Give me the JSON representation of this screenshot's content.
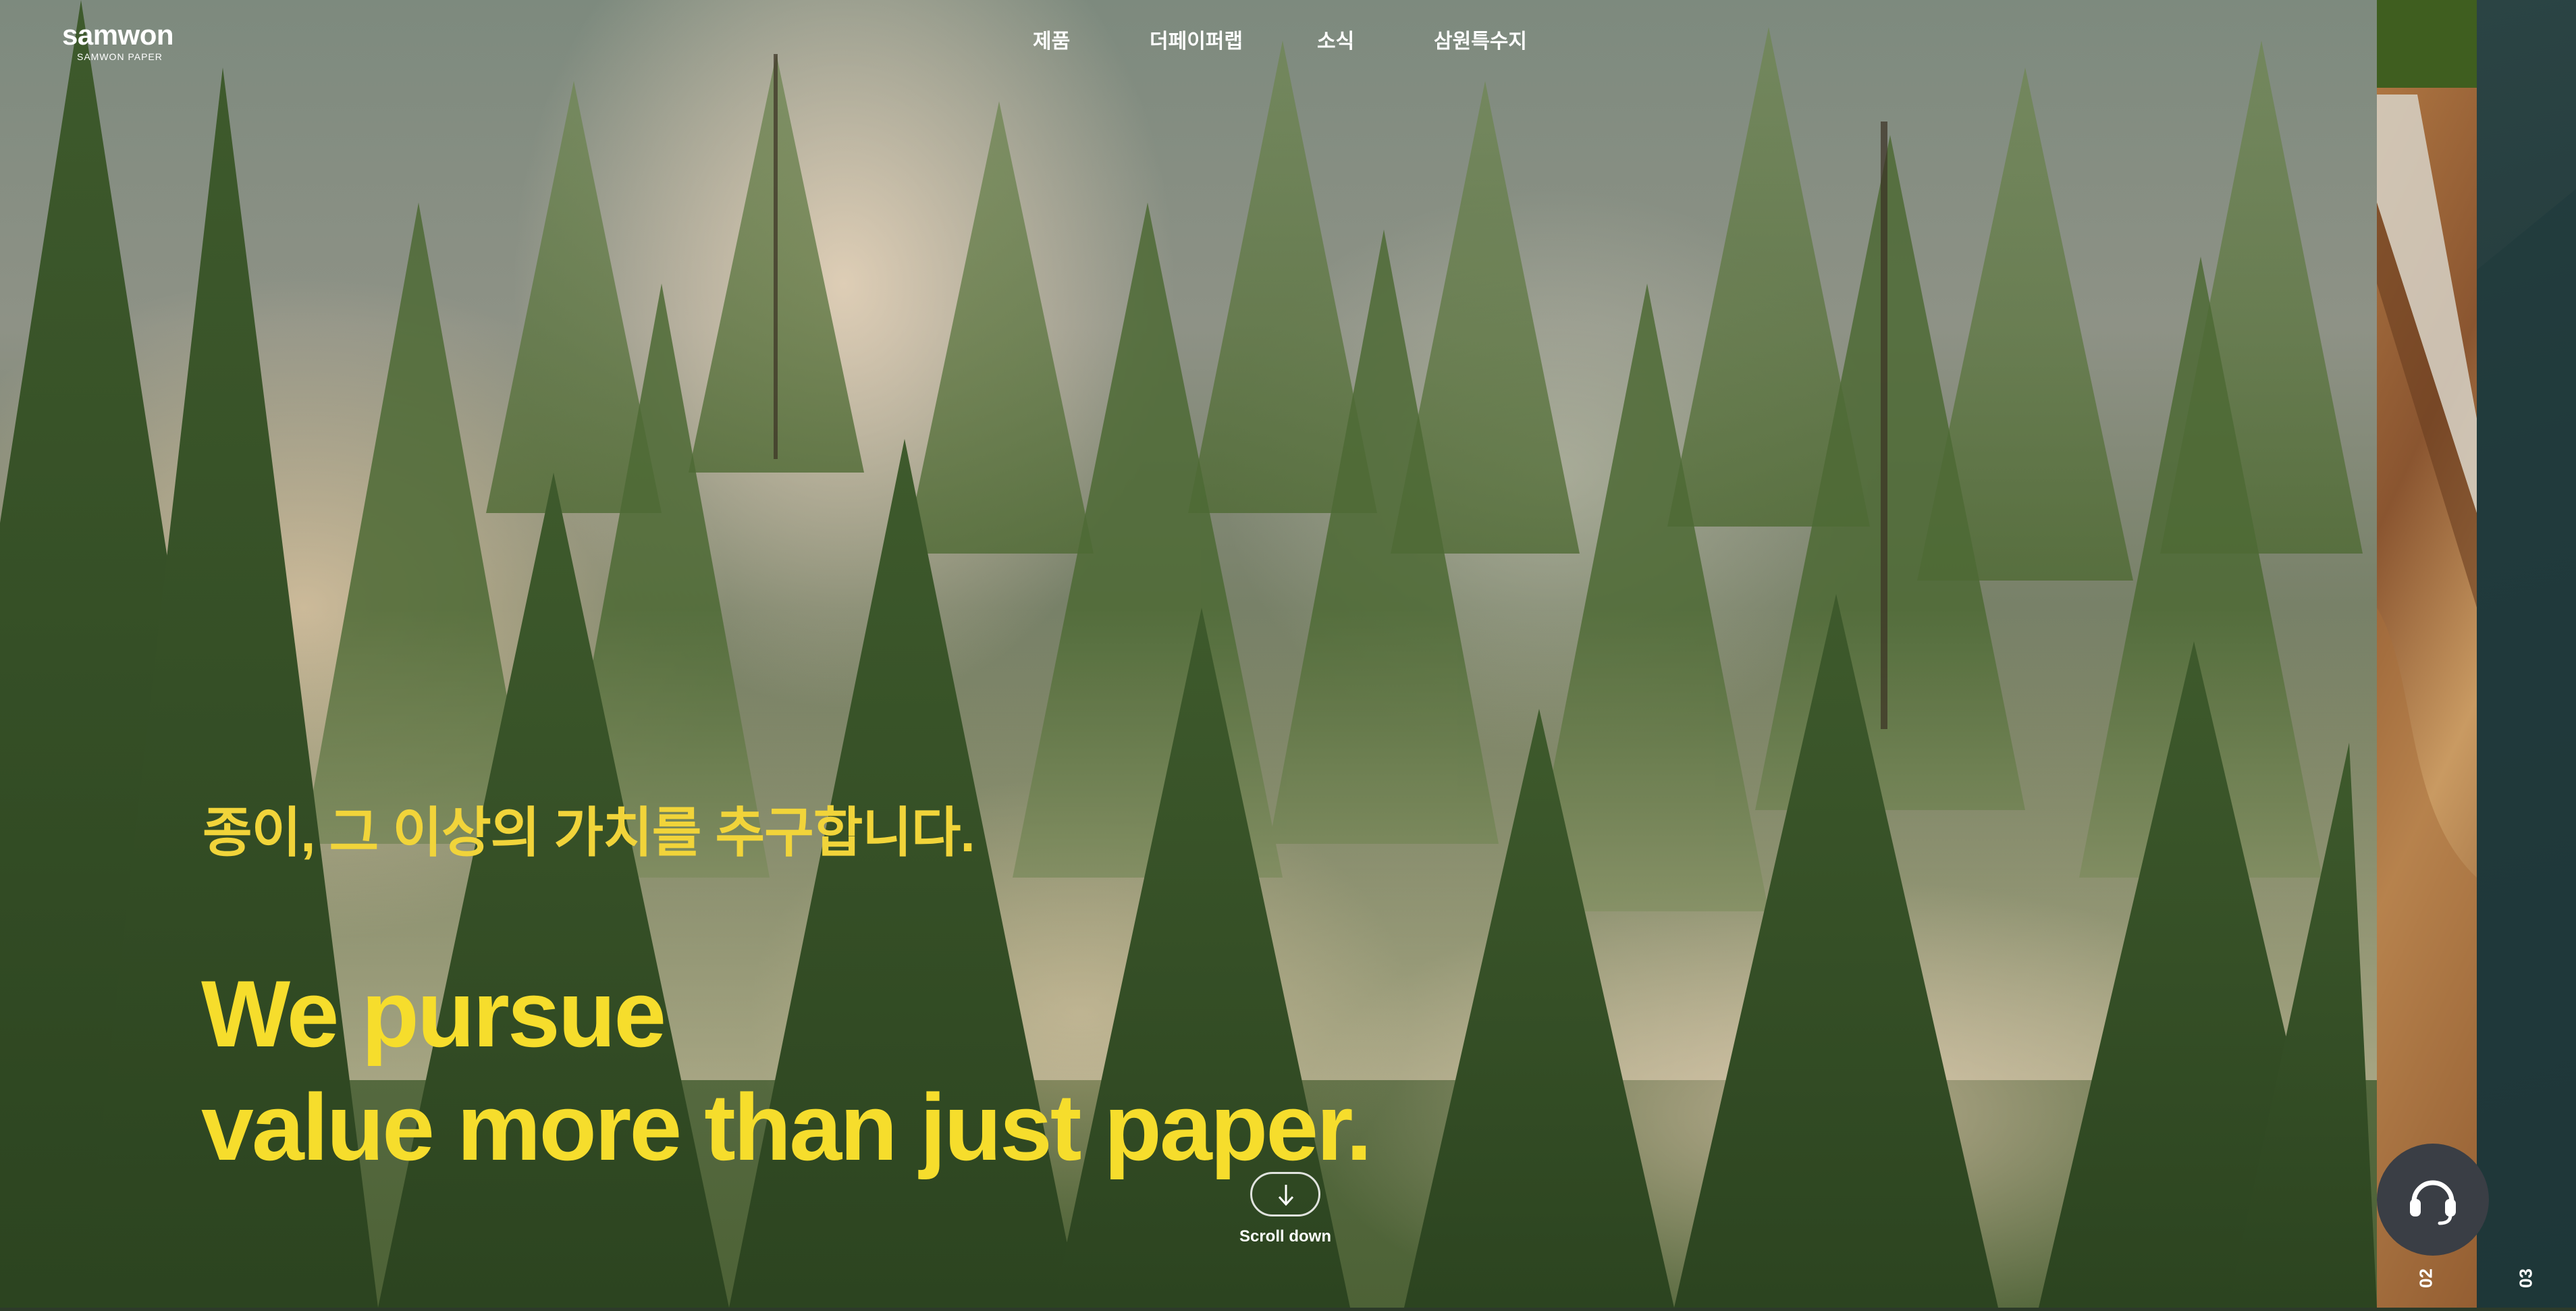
{
  "brand": {
    "logo_word": "samwon",
    "logo_sub": "SAMWON PAPER"
  },
  "nav": {
    "items": [
      {
        "label": "제품"
      },
      {
        "label": "더페이퍼랩"
      },
      {
        "label": "소식"
      },
      {
        "label": "삼원특수지"
      }
    ]
  },
  "header_icons": {
    "search": "search-icon",
    "menu": "hamburger-menu-icon"
  },
  "hero": {
    "subtitle": "종이, 그 이상의 가치를 추구합니다.",
    "title_line1": "We pursue",
    "title_line2": "value more than just paper.",
    "scroll_label": "Scroll down"
  },
  "slides": {
    "next_1": "02",
    "next_2": "03"
  },
  "contact": {
    "icon": "headset-icon"
  },
  "colors": {
    "accent_yellow": "#f6dd2c",
    "contact_bg": "#3a3e45",
    "panel_03_bg": "#233a3c"
  }
}
